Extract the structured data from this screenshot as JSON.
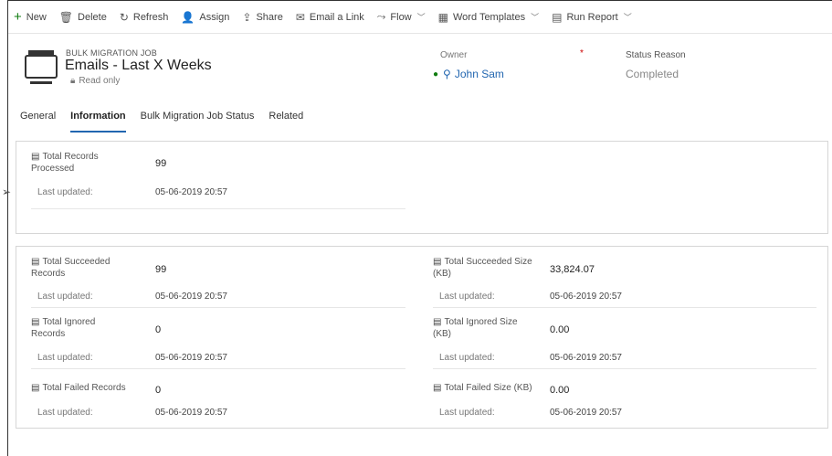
{
  "commands": [
    {
      "icon": "+",
      "label": "New"
    },
    {
      "icon": "🗑",
      "label": "Delete"
    },
    {
      "icon": "↻",
      "label": "Refresh"
    },
    {
      "icon": "👤",
      "label": "Assign"
    },
    {
      "icon": "⇪",
      "label": "Share"
    },
    {
      "icon": "✉",
      "label": "Email a Link"
    },
    {
      "icon": "⤳",
      "label": "Flow"
    },
    {
      "icon": "▦",
      "label": "Word Templates"
    },
    {
      "icon": "▤",
      "label": "Run Report"
    }
  ],
  "header": {
    "entity_type": "BULK MIGRATION JOB",
    "title": "Emails - Last X Weeks",
    "readonly": "Read only",
    "owner_label": "Owner",
    "owner_name": "John Sam",
    "required_marker": "*",
    "status_label": "Status Reason",
    "status_value": "Completed"
  },
  "tabs": [
    "General",
    "Information",
    "Bulk Migration Job Status",
    "Related"
  ],
  "active_tab": "Information",
  "section1": [
    {
      "label": "Total Records Processed",
      "value": "99",
      "last_updated_label": "Last updated:",
      "last_updated": "05-06-2019 20:57"
    }
  ],
  "section2": {
    "left": [
      {
        "label": "Total Succeeded Records",
        "value": "99",
        "last_updated_label": "Last updated:",
        "last_updated": "05-06-2019 20:57"
      },
      {
        "label": "Total Ignored Records",
        "value": "0",
        "last_updated_label": "Last updated:",
        "last_updated": "05-06-2019 20:57"
      },
      {
        "label": "Total Failed Records",
        "value": "0",
        "last_updated_label": "Last updated:",
        "last_updated": "05-06-2019 20:57"
      }
    ],
    "right": [
      {
        "label": "Total Succeeded Size (KB)",
        "value": "33,824.07",
        "last_updated_label": "Last updated:",
        "last_updated": "05-06-2019 20:57"
      },
      {
        "label": "Total Ignored Size (KB)",
        "value": "0.00",
        "last_updated_label": "Last updated:",
        "last_updated": "05-06-2019 20:57"
      },
      {
        "label": "Total Failed Size (KB)",
        "value": "0.00",
        "last_updated_label": "Last updated:",
        "last_updated": "05-06-2019 20:57"
      }
    ]
  },
  "colors": {
    "accent": "#2266b0",
    "new_icon": "#107c10",
    "required": "#cc0000"
  }
}
